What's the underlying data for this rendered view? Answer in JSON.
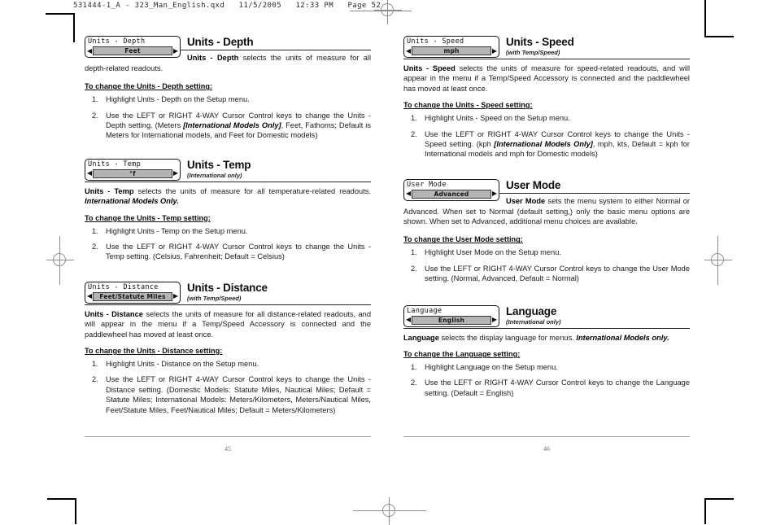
{
  "slug": {
    "text": "531444-1_A - 323_Man_English.qxd   11/5/2005   12:33 PM   Page 52"
  },
  "left_page": {
    "number": "45",
    "sections": [
      {
        "id": "units-depth",
        "lcd_title": "Units - Depth",
        "lcd_value": "Feet",
        "heading": "Units - Depth",
        "subheading": "",
        "body_lead": "Units - Depth",
        "body_rest": " selects the units of measure for all depth-related readouts.",
        "howto": "To change the Units - Depth setting:",
        "steps": [
          {
            "num": "1.",
            "text": "Highlight Units - Depth on the Setup menu."
          },
          {
            "num": "2.",
            "pre": "Use the LEFT or RIGHT 4-WAY Cursor Control keys to change the Units - Depth setting. (Meters ",
            "em": "[International Models Only]",
            "post": ", Feet, Fathoms; Default is Meters for International models, and Feet for Domestic models)"
          }
        ]
      },
      {
        "id": "units-temp",
        "lcd_title": "Units - Temp",
        "lcd_value": "°f",
        "heading": "Units - Temp",
        "subheading": "(International only)",
        "body_lead": "Units - Temp",
        "body_rest": " selects the units of measure for all temperature-related readouts. ",
        "body_em": "International Models Only.",
        "howto": "To change the Units - Temp setting:",
        "steps": [
          {
            "num": "1.",
            "text": "Highlight Units - Temp on the Setup menu."
          },
          {
            "num": "2.",
            "pre": "Use the LEFT or RIGHT 4-WAY Cursor Control keys to change the Units - Temp setting. (Celsius, Fahrenheit; Default = Celsius)",
            "em": "",
            "post": ""
          }
        ]
      },
      {
        "id": "units-distance",
        "lcd_title": "Units - Distance",
        "lcd_value": "Feet/Statute Miles",
        "heading": "Units - Distance",
        "subheading": "(with Temp/Speed)",
        "body_lead": "Units - Distance",
        "body_rest": " selects the units of measure for all distance-related readouts, and will appear in the menu if a Temp/Speed Accessory is connected and the paddlewheel has moved at least once.",
        "howto": "To change the Units - Distance setting:",
        "steps": [
          {
            "num": "1.",
            "text": "Highlight Units - Distance on the Setup menu."
          },
          {
            "num": "2.",
            "pre": "Use the LEFT or RIGHT 4-WAY Cursor Control keys to change the Units - Distance setting. (Domestic Models: Statute Miles, Nautical Miles; Default = Statute Miles; International Models: Meters/Kilometers, Meters/Nautical Miles, Feet/Statute Miles, Feet/Nautical Miles; Default = Meters/Kilometers)",
            "em": "",
            "post": ""
          }
        ]
      }
    ]
  },
  "right_page": {
    "number": "46",
    "sections": [
      {
        "id": "units-speed",
        "lcd_title": "Units - Speed",
        "lcd_value": "mph",
        "heading": "Units - Speed",
        "subheading": "(with Temp/Speed)",
        "body_lead": "Units - Speed",
        "body_rest": " selects the units of measure for speed-related readouts, and will appear in the menu if a Temp/Speed Accessory is connected and the paddlewheel has moved at least once.",
        "howto": "To change the Units - Speed setting:",
        "steps": [
          {
            "num": "1.",
            "text": "Highlight Units - Speed on the Setup menu."
          },
          {
            "num": "2.",
            "pre": "Use the LEFT or RIGHT 4-WAY Cursor Control keys to change the Units - Speed setting. (kph ",
            "em": "[International Models Only]",
            "post": ", mph, kts, Default = kph for International models and mph for Domestic models)"
          }
        ]
      },
      {
        "id": "user-mode",
        "lcd_title": "User Mode",
        "lcd_value": "Advanced",
        "heading": "User Mode",
        "subheading": "",
        "body_lead": "User Mode",
        "body_rest": " sets the menu system to either Normal or Advanced. When set to Normal (default setting,) only the basic menu options are shown.  When set to Advanced, additional menu choices are available.",
        "howto": "To change the User Mode setting:",
        "steps": [
          {
            "num": "1.",
            "text": "Highlight User Mode on the Setup menu."
          },
          {
            "num": "2.",
            "pre": "Use the LEFT or RIGHT 4-WAY Cursor Control keys to change the User Mode setting. (Normal, Advanced, Default = Normal)",
            "em": "",
            "post": ""
          }
        ]
      },
      {
        "id": "language",
        "lcd_title": "Language",
        "lcd_value": "English",
        "heading": "Language",
        "subheading": "(International only)",
        "body_lead": "Language",
        "body_rest": " selects the display language for menus. ",
        "body_em": "International Models only.",
        "howto": "To change the Language setting:",
        "steps": [
          {
            "num": "1.",
            "text": "Highlight Language on the Setup menu."
          },
          {
            "num": "2.",
            "pre": "Use the LEFT or RIGHT 4-WAY Cursor Control keys to change the Language setting. (Default = English)",
            "em": "",
            "post": ""
          }
        ]
      }
    ]
  },
  "icons": {
    "left_arrow": "◀",
    "right_arrow": "▶"
  }
}
